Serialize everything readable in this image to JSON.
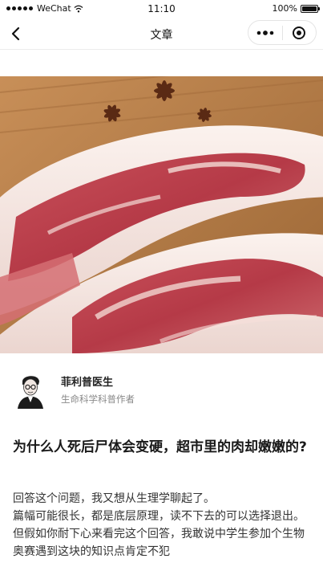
{
  "status_bar": {
    "carrier": "WeChat",
    "time": "11:10",
    "battery": "100%",
    "battery_level": 1.0
  },
  "nav": {
    "title": "文章",
    "back_icon": "chevron-left-icon",
    "more_icon": "more-dots-icon",
    "close_icon": "target-icon"
  },
  "hero": {
    "icon": "pork-meat-photo"
  },
  "author": {
    "name": "菲利普医生",
    "role": "生命科学科普作者"
  },
  "article": {
    "title": "为什么人死后尸体会变硬，超市里的肉却嫩嫩的?",
    "paragraphs": [
      "回答这个问题，我又想从生理学聊起了。",
      "篇幅可能很长，都是底层原理，读不下去的可以选择退出。但假如你耐下心来看完这个回答，我敢说中学生参加个生物奥赛遇到这块的知识点肯定不犯"
    ]
  }
}
